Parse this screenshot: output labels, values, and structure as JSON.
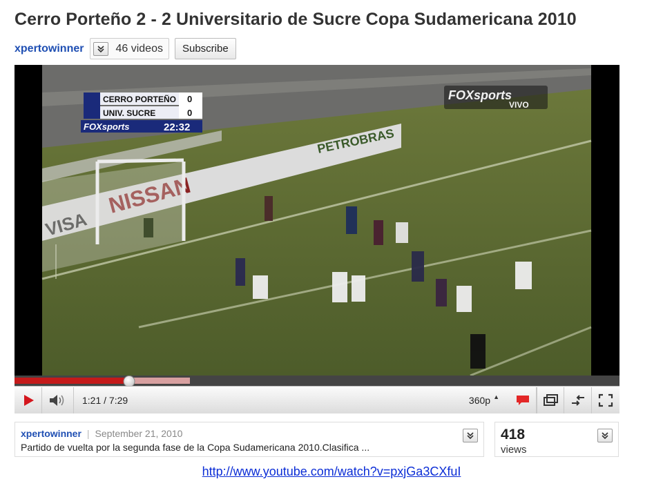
{
  "video_title": "Cerro Porteño 2 - 2 Universitario de Sucre Copa Sudamericana 2010",
  "channel": {
    "name": "xpertowinner",
    "videos_count": "46 videos",
    "subscribe_label": "Subscribe"
  },
  "player": {
    "scoreboard": {
      "team1": "CERRO PORTEÑO",
      "score1": "0",
      "team2": "UNIV. SUCRE",
      "score2": "0",
      "network": "FOXsports",
      "clock": "22:32"
    },
    "broadcaster_logo": {
      "main": "FOXsports",
      "sub": "VIVO"
    },
    "ad_boards": [
      "NISSAN",
      "VISA",
      "PETROBRAS"
    ],
    "progress": {
      "played_fraction": 0.19,
      "loaded_fraction": 0.29,
      "accent": "#c41a1a"
    },
    "controls": {
      "time": "1:21 / 7:29",
      "quality": "360p",
      "icons": [
        "play-icon",
        "volume-icon",
        "captions-icon",
        "popout-icon",
        "embed-icon",
        "fullscreen-icon"
      ]
    }
  },
  "description": {
    "user": "xpertowinner",
    "separator": "|",
    "date": "September 21, 2010",
    "text": "Partido de vuelta por la segunda fase de la Copa Sudamericana 2010.Clasifica ..."
  },
  "views": {
    "count": "418",
    "label": "views"
  },
  "source_url": "http://www.youtube.com/watch?v=pxjGa3CXfuI"
}
